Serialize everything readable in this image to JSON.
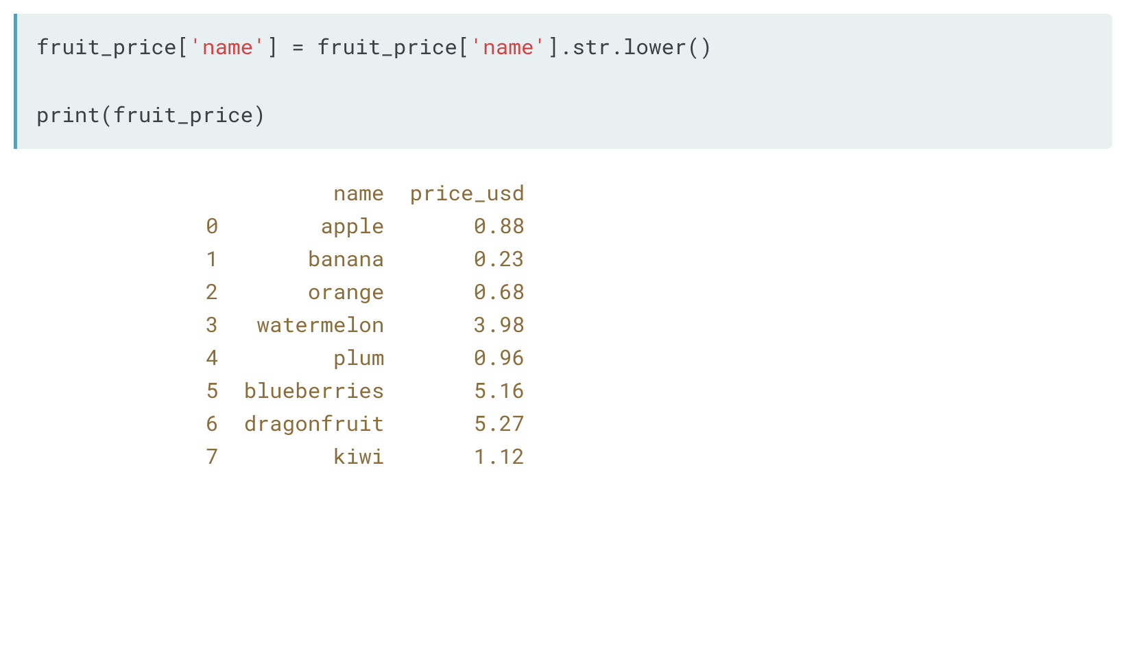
{
  "code": {
    "line1_prefix": "fruit_price[",
    "line1_string1": "'name'",
    "line1_mid": "] = fruit_price[",
    "line1_string2": "'name'",
    "line1_suffix": "].str.lower()",
    "blank": "",
    "line2": "print(fruit_price)"
  },
  "output": {
    "header": "          name  price_usd",
    "rows": [
      "0        apple       0.88",
      "1       banana       0.23",
      "2       orange       0.68",
      "3   watermelon       3.98",
      "4         plum       0.96",
      "5  blueberries       5.16",
      "6  dragonfruit       5.27",
      "7         kiwi       1.12"
    ]
  },
  "chart_data": {
    "type": "table",
    "columns": [
      "index",
      "name",
      "price_usd"
    ],
    "rows": [
      [
        0,
        "apple",
        0.88
      ],
      [
        1,
        "banana",
        0.23
      ],
      [
        2,
        "orange",
        0.68
      ],
      [
        3,
        "watermelon",
        3.98
      ],
      [
        4,
        "plum",
        0.96
      ],
      [
        5,
        "blueberries",
        5.16
      ],
      [
        6,
        "dragonfruit",
        5.27
      ],
      [
        7,
        "kiwi",
        1.12
      ]
    ]
  }
}
